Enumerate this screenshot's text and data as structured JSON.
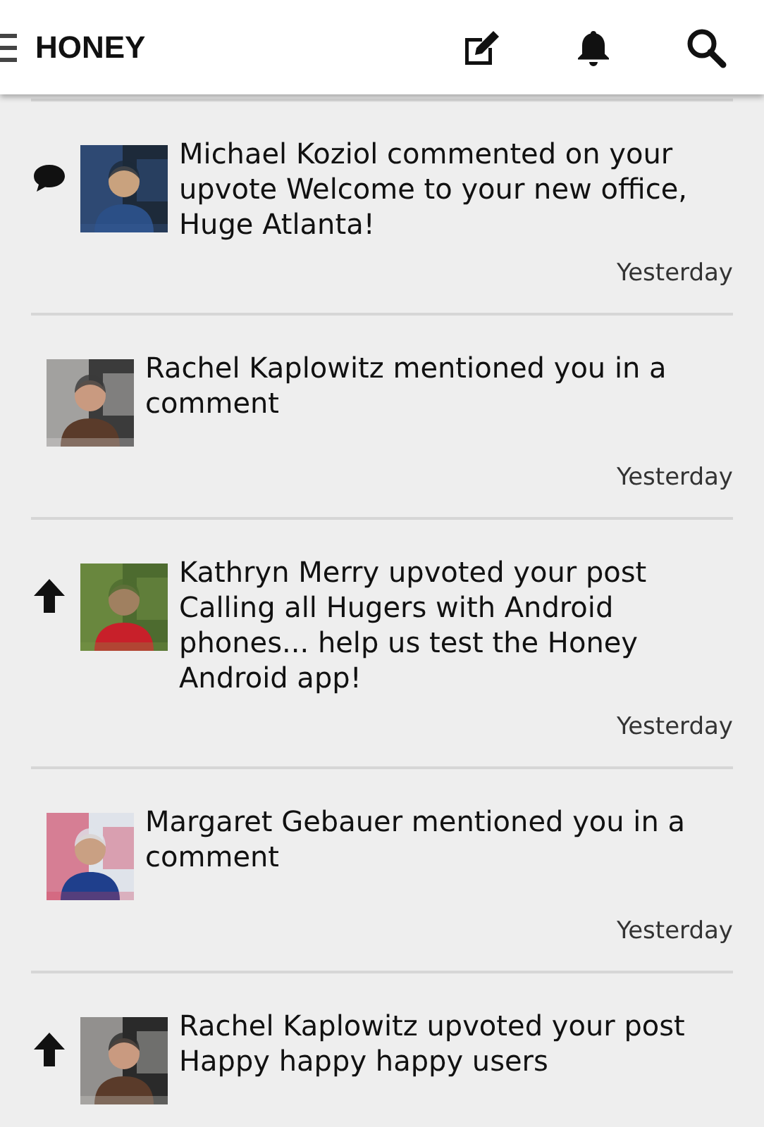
{
  "header": {
    "title": "HONEY"
  },
  "notifications": [
    {
      "kind": "comment",
      "text": "Michael Koziol commented on your upvote Welcome to your new office, Huge Atlanta!",
      "time": "Yesterday"
    },
    {
      "kind": "mention",
      "text": "Rachel Kaplowitz mentioned you in a comment",
      "time": "Yesterday"
    },
    {
      "kind": "upvote",
      "text": "Kathryn Merry upvoted your post Calling all Hugers with Android phones... help us test the Honey Android app!",
      "time": "Yesterday"
    },
    {
      "kind": "mention",
      "text": "Margaret Gebauer mentioned you in a comment",
      "time": "Yesterday"
    },
    {
      "kind": "upvote",
      "text": "Rachel Kaplowitz upvoted your post Happy happy happy users"
    }
  ]
}
